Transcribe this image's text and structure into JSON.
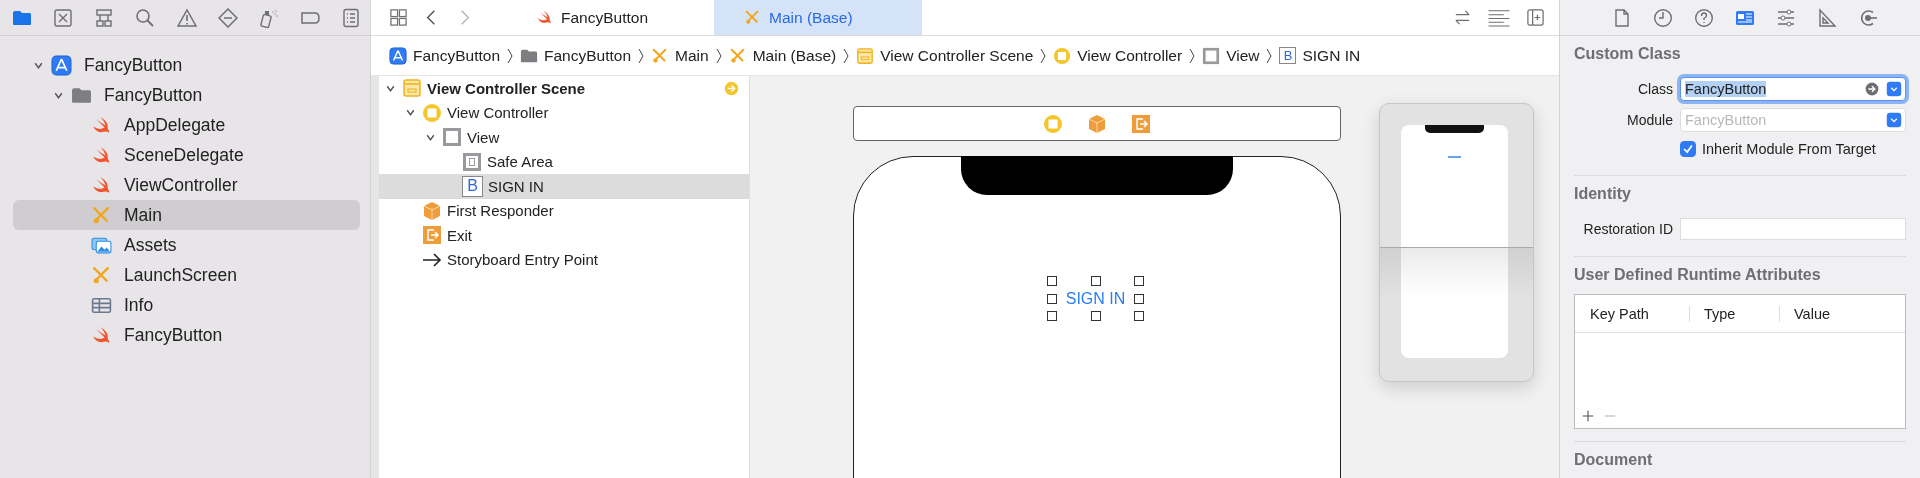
{
  "navigator_toolbar": [
    {
      "kind": "folder",
      "selected": true
    },
    {
      "kind": "xbox",
      "selected": false
    },
    {
      "kind": "hierarchy",
      "selected": false
    },
    {
      "kind": "search",
      "selected": false
    },
    {
      "kind": "warning",
      "selected": false
    },
    {
      "kind": "diamond",
      "selected": false
    },
    {
      "kind": "spray",
      "selected": false
    },
    {
      "kind": "tag",
      "selected": false
    },
    {
      "kind": "list",
      "selected": false
    }
  ],
  "navigator": {
    "items": [
      {
        "label": "FancyButton",
        "kind": "project",
        "selected": false,
        "expanded": true,
        "children": [
          {
            "label": "FancyButton",
            "kind": "folder",
            "selected": false,
            "expanded": true,
            "children": [
              {
                "label": "AppDelegate",
                "kind": "swift",
                "selected": false
              },
              {
                "label": "SceneDelegate",
                "kind": "swift",
                "selected": false
              },
              {
                "label": "ViewController",
                "kind": "swift",
                "selected": false
              },
              {
                "label": "Main",
                "kind": "storyboard",
                "selected": true
              },
              {
                "label": "Assets",
                "kind": "assets",
                "selected": false
              },
              {
                "label": "LaunchScreen",
                "kind": "storyboard",
                "selected": false
              },
              {
                "label": "Info",
                "kind": "plist",
                "selected": false
              },
              {
                "label": "FancyButton",
                "kind": "swift",
                "selected": false
              }
            ]
          }
        ]
      }
    ]
  },
  "editor_tabs": [
    {
      "label": "FancyButton",
      "kind": "swift",
      "selected": false
    },
    {
      "label": "Main (Base)",
      "kind": "storyboard",
      "selected": true
    }
  ],
  "breadcrumb": [
    {
      "label": "FancyButton",
      "kind": "project"
    },
    {
      "label": "FancyButton",
      "kind": "folder"
    },
    {
      "label": "Main",
      "kind": "storyboard"
    },
    {
      "label": "Main (Base)",
      "kind": "storyboard"
    },
    {
      "label": "View Controller Scene",
      "kind": "scene"
    },
    {
      "label": "View Controller",
      "kind": "controller"
    },
    {
      "label": "View",
      "kind": "view"
    },
    {
      "label": "SIGN IN",
      "kind": "button",
      "icon_text": "B"
    }
  ],
  "outline": {
    "items": [
      {
        "label": "View Controller Scene",
        "kind": "scene",
        "selected": false,
        "expanded": true,
        "children": [
          {
            "label": "View Controller",
            "kind": "controller",
            "selected": false,
            "expanded": true,
            "children": [
              {
                "label": "View",
                "kind": "view",
                "selected": false,
                "expanded": true,
                "children": [
                  {
                    "label": "Safe Area",
                    "kind": "safe-area",
                    "selected": false
                  },
                  {
                    "label": "SIGN IN",
                    "kind": "button",
                    "icon_text": "B",
                    "selected": true
                  }
                ]
              }
            ]
          },
          {
            "label": "First Responder",
            "kind": "responder",
            "selected": false
          },
          {
            "label": "Exit",
            "kind": "exit",
            "selected": false
          },
          {
            "label": "Storyboard Entry Point",
            "kind": "entry",
            "selected": false
          }
        ]
      }
    ]
  },
  "canvas": {
    "scene_dock": [
      {
        "kind": "controller"
      },
      {
        "kind": "responder"
      },
      {
        "kind": "exit"
      }
    ],
    "button_label": "SIGN IN"
  },
  "inspector_tabs": [
    {
      "kind": "file",
      "selected": false
    },
    {
      "kind": "clock",
      "selected": false
    },
    {
      "kind": "help",
      "selected": false
    },
    {
      "kind": "identity",
      "selected": true
    },
    {
      "kind": "sliders",
      "selected": false
    },
    {
      "kind": "ruler",
      "selected": false
    },
    {
      "kind": "connections",
      "selected": false
    }
  ],
  "custom_class": {
    "title": "Custom Class",
    "class_label": "Class",
    "class_value": "FancyButton",
    "module_label": "Module",
    "module_placeholder": "FancyButton",
    "inherit_label": "Inherit Module From Target",
    "inherit_checked": true
  },
  "identity": {
    "title": "Identity",
    "restoration_label": "Restoration ID"
  },
  "runtime_attributes": {
    "title": "User Defined Runtime Attributes",
    "columns": [
      "Key Path",
      "Type",
      "Value"
    ]
  },
  "document": {
    "title": "Document"
  }
}
